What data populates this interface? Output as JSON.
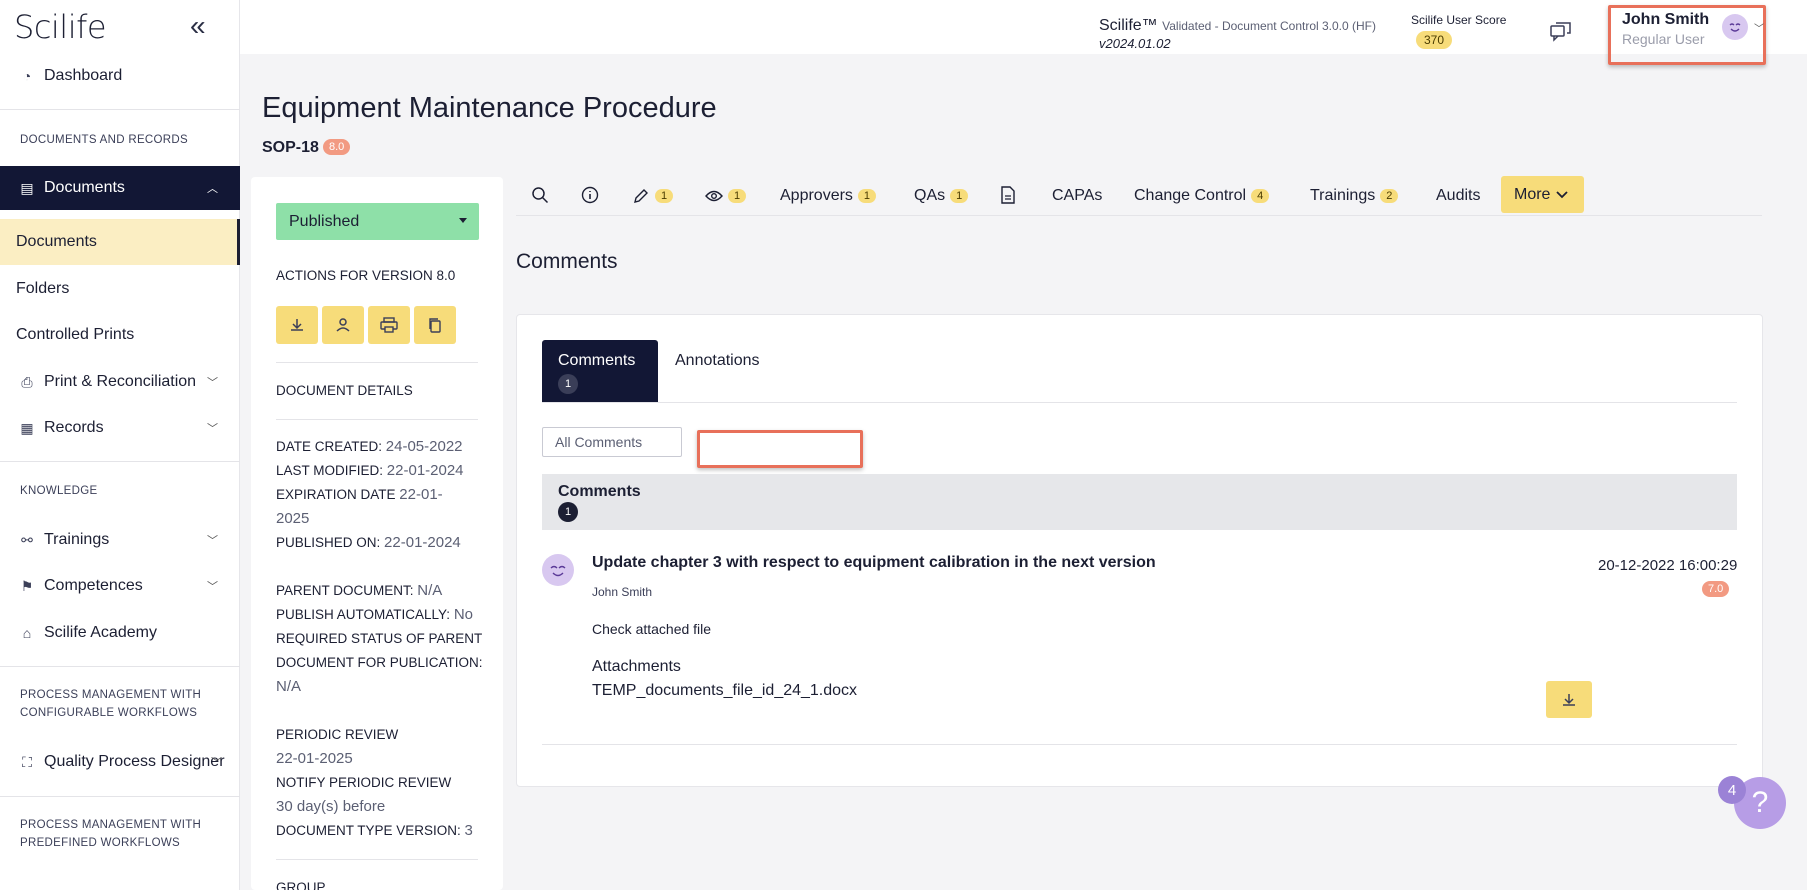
{
  "app": {
    "logo": "Scilife",
    "name": "Scilife™",
    "subtitle": "Validated - Document Control 3.0.0 (HF)",
    "version": "v2024.01.02",
    "score_label": "Scilife User Score",
    "score_value": "370"
  },
  "user": {
    "name": "John Smith",
    "role": "Regular User"
  },
  "sidebar": {
    "dashboard": "Dashboard",
    "section_docs": "DOCUMENTS AND RECORDS",
    "documents_group": "Documents",
    "documents": "Documents",
    "folders": "Folders",
    "controlled_prints": "Controlled Prints",
    "print_reconciliation": "Print & Reconciliation",
    "records": "Records",
    "section_knowledge": "KNOWLEDGE",
    "trainings": "Trainings",
    "competences": "Competences",
    "academy": "Scilife Academy",
    "section_pm_config": "PROCESS MANAGEMENT WITH CONFIGURABLE WORKFLOWS",
    "qpd": "Quality Process Designer",
    "section_pm_predef": "PROCESS MANAGEMENT WITH PREDEFINED WORKFLOWS",
    "partial_item": "Quality ... Design..."
  },
  "doc": {
    "title": "Equipment Maintenance Procedure",
    "id": "SOP-18",
    "version": "8.0",
    "status": "Published",
    "actions_label": "ACTIONS FOR VERSION 8.0",
    "details_label": "DOCUMENT DETAILS",
    "date_created_label": "DATE CREATED:",
    "date_created": "24-05-2022",
    "last_modified_label": "LAST MODIFIED:",
    "last_modified": "22-01-2024",
    "expiration_label": "EXPIRATION DATE",
    "expiration_part1": "22-01-",
    "expiration_part2": "2025",
    "published_on_label": "PUBLISHED ON:",
    "published_on": "22-01-2024",
    "parent_doc_label": "PARENT DOCUMENT:",
    "parent_doc": "N/A",
    "publish_auto_label": "PUBLISH AUTOMATICALLY:",
    "publish_auto": "No",
    "required_status_label1": "REQUIRED STATUS OF PARENT",
    "required_status_label2": "DOCUMENT FOR PUBLICATION:",
    "required_status": "N/A",
    "periodic_review_label": "PERIODIC REVIEW",
    "periodic_review": "22-01-2025",
    "notify_label": "NOTIFY PERIODIC REVIEW",
    "notify": "30 day(s) before",
    "type_version_label": "DOCUMENT TYPE VERSION:",
    "type_version": "3",
    "group_label": "GROUP"
  },
  "tabs": {
    "edit_count": "1",
    "view_count": "1",
    "approvers": "Approvers",
    "approvers_count": "1",
    "qas": "QAs",
    "qas_count": "1",
    "capas": "CAPAs",
    "change_control": "Change Control",
    "change_control_count": "4",
    "trainings": "Trainings",
    "trainings_count": "2",
    "audits": "Audits",
    "more": "More"
  },
  "comments": {
    "section_title": "Comments",
    "tab_comments": "Comments",
    "tab_comments_count": "1",
    "tab_annotations": "Annotations",
    "filter_value": "All Comments",
    "search_value": "",
    "header_label": "Comments",
    "header_count": "1",
    "items": [
      {
        "title": "Update chapter 3 with respect to equipment calibration in the next version",
        "author": "John Smith",
        "date": "20-12-2022 16:00:29",
        "version": "7.0",
        "body": "Check attached file",
        "attachments_label": "Attachments",
        "attachment_file": "TEMP_documents_file_id_24_1.docx"
      }
    ]
  },
  "help": {
    "badge": "4",
    "icon": "?"
  },
  "colors": {
    "navy": "#121735",
    "accent_yellow": "#f7dc7a",
    "status_green": "#8ee0a8",
    "version_orange": "#f29a82",
    "highlight_red": "#e8705a",
    "help_purple": "#b79de6"
  }
}
